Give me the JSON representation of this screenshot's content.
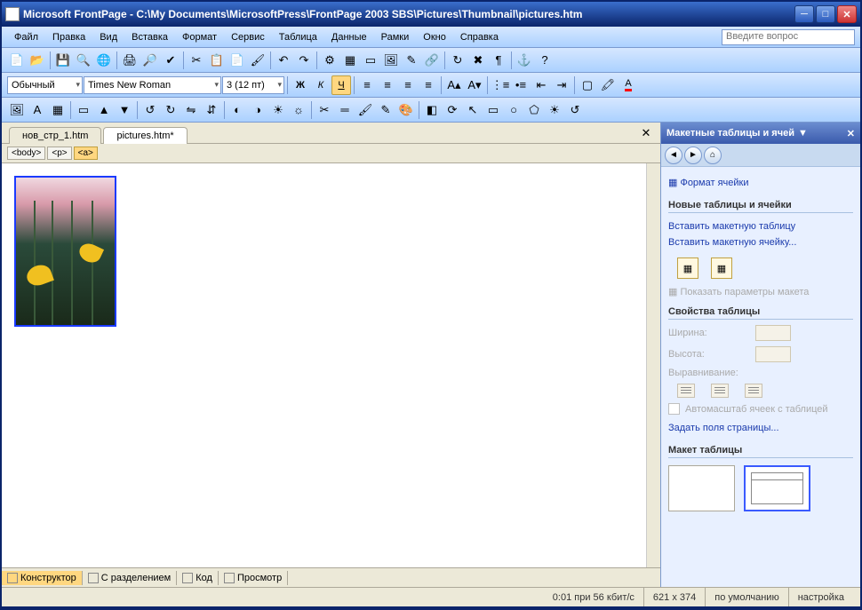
{
  "titlebar": {
    "app_icon": "🅼",
    "title": "Microsoft FrontPage - C:\\My Documents\\MicrosoftPress\\FrontPage 2003 SBS\\Pictures\\Thumbnail\\pictures.htm"
  },
  "menu": {
    "items": [
      "Файл",
      "Правка",
      "Вид",
      "Вставка",
      "Формат",
      "Сервис",
      "Таблица",
      "Данные",
      "Рамки",
      "Окно",
      "Справка"
    ],
    "help_placeholder": "Введите вопрос"
  },
  "format_toolbar": {
    "style": "Обычный",
    "font": "Times New Roman",
    "size": "3 (12 пт)",
    "bold": "Ж",
    "italic": "К",
    "underline": "Ч"
  },
  "doc_tabs": {
    "tab1": "нов_стр_1.htm",
    "tab2": "pictures.htm*"
  },
  "breadcrumb": {
    "t0": "<body>",
    "t1": "<p>",
    "t2": "<a>"
  },
  "view_tabs": {
    "design": "Конструктор",
    "split": "С разделением",
    "code": "Код",
    "preview": "Просмотр"
  },
  "task_pane": {
    "title": "Макетные таблицы и ячей",
    "cell_format": "Формат ячейки",
    "new_section": "Новые таблицы и ячейки",
    "insert_table": "Вставить макетную таблицу",
    "insert_cell": "Вставить макетную ячейку...",
    "show_params": "Показать параметры макета",
    "props_section": "Свойства таблицы",
    "width_label": "Ширина:",
    "height_label": "Высота:",
    "align_label": "Выравнивание:",
    "autoscale": "Автомасштаб ячеек с таблицей",
    "set_margins": "Задать поля страницы...",
    "layout_section": "Макет таблицы"
  },
  "statusbar": {
    "time": "0:01 при 56 кбит/с",
    "dims": "621 x 374",
    "default": "по умолчанию",
    "custom": "настройка"
  }
}
